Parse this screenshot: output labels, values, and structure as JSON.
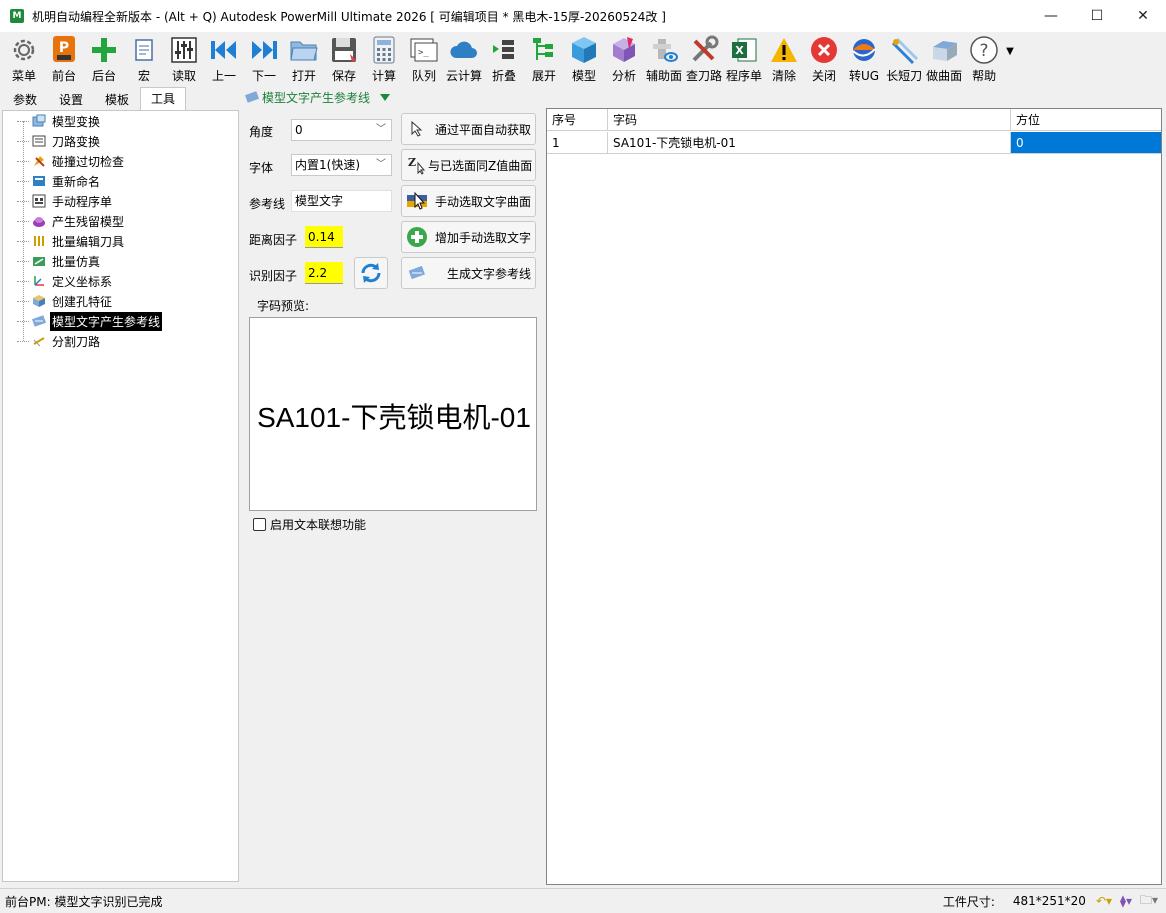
{
  "window": {
    "title": "机明自动编程全新版本 - (Alt + Q) Autodesk PowerMill Ultimate 2026   [ 可编辑项目 * 黑电木-15厚-20260524改 ]",
    "minimize": "—",
    "maximize": "☐",
    "close": "✕"
  },
  "toolbar": {
    "items": [
      {
        "label": "菜单",
        "icon": "gear-icon"
      },
      {
        "label": "前台",
        "icon": "powermill-icon"
      },
      {
        "label": "后台",
        "icon": "plus-icon"
      },
      {
        "label": "宏",
        "icon": "macro-icon"
      },
      {
        "label": "读取",
        "icon": "sliders-icon"
      },
      {
        "label": "上一",
        "icon": "previous-icon"
      },
      {
        "label": "下一",
        "icon": "next-icon"
      },
      {
        "label": "打开",
        "icon": "folder-open-icon"
      },
      {
        "label": "保存",
        "icon": "save-icon"
      },
      {
        "label": "计算",
        "icon": "calculator-icon"
      },
      {
        "label": "队列",
        "icon": "queue-icon"
      },
      {
        "label": "云计算",
        "icon": "cloud-icon"
      },
      {
        "label": "折叠",
        "icon": "collapse-icon"
      },
      {
        "label": "展开",
        "icon": "expand-icon"
      },
      {
        "label": "模型",
        "icon": "model-cube-icon"
      },
      {
        "label": "分析",
        "icon": "analysis-icon"
      },
      {
        "label": "辅助面",
        "icon": "aux-surface-icon"
      },
      {
        "label": "查刀路",
        "icon": "tools-icon"
      },
      {
        "label": "程序单",
        "icon": "excel-icon"
      },
      {
        "label": "清除",
        "icon": "warning-icon"
      },
      {
        "label": "关闭",
        "icon": "close-circle-icon"
      },
      {
        "label": "转UG",
        "icon": "nx-icon"
      },
      {
        "label": "长短刀",
        "icon": "tool-length-icon"
      },
      {
        "label": "做曲面",
        "icon": "surface-icon"
      },
      {
        "label": "帮助",
        "icon": "help-icon"
      }
    ]
  },
  "left": {
    "tabs": [
      "参数",
      "设置",
      "模板",
      "工具"
    ],
    "active_tab": "工具",
    "tree": [
      "模型变换",
      "刀路变换",
      "碰撞过切检查",
      "重新命名",
      "手动程序单",
      "产生残留模型",
      "批量编辑刀具",
      "批量仿真",
      "定义坐标系",
      "创建孔特征",
      "模型文字产生参考线",
      "分割刀路"
    ],
    "selected": "模型文字产生参考线"
  },
  "mid": {
    "header": "模型文字产生参考线",
    "angle_label": "角度",
    "angle_value": "0",
    "font_label": "字体",
    "font_value": "内置1(快速)",
    "refline_label": "参考线",
    "refline_value": "模型文字",
    "distance_label": "距离因子",
    "distance_value": "0.14",
    "recog_label": "识别因子",
    "recog_value": "2.2",
    "btn_auto": "通过平面自动获取",
    "btn_samez": "与已选面同Z值曲面",
    "btn_manual": "手动选取文字曲面",
    "btn_add": "增加手动选取文字",
    "btn_generate": "生成文字参考线",
    "preview_title": "字码预览:",
    "preview_text": "SA101-下壳锁电机-01",
    "checkbox_label": "启用文本联想功能"
  },
  "grid": {
    "columns": [
      "序号",
      "字码",
      "方位"
    ],
    "rows": [
      {
        "idx": "1",
        "code": "SA101-下壳锁电机-01",
        "dir": "0"
      }
    ]
  },
  "status": {
    "left": "前台PM: 模型文字识别已完成",
    "size_label": "工件尺寸:",
    "size_value": "481*251*20"
  }
}
